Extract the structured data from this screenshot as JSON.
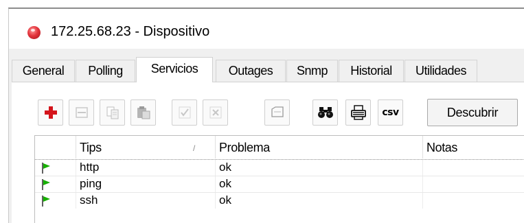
{
  "window": {
    "title": "172.25.68.23 - Dispositivo"
  },
  "tabs": [
    {
      "label": "General"
    },
    {
      "label": "Polling"
    },
    {
      "label": "Servicios",
      "active": true
    },
    {
      "label": "Outages"
    },
    {
      "label": "Snmp"
    },
    {
      "label": "Historial"
    },
    {
      "label": "Utilidades"
    }
  ],
  "toolbar": {
    "buttons": [
      {
        "icon": "add-icon",
        "enabled": true
      },
      {
        "icon": "remove-icon",
        "enabled": false
      },
      {
        "icon": "copy-icon",
        "enabled": false
      },
      {
        "icon": "paste-icon",
        "enabled": false
      },
      {
        "icon": "check-icon",
        "enabled": false
      },
      {
        "icon": "cross-icon",
        "enabled": false
      },
      {
        "icon": "comment-icon",
        "enabled": false
      },
      {
        "icon": "binoculars-icon",
        "enabled": true
      },
      {
        "icon": "printer-icon",
        "enabled": true
      },
      {
        "icon": "csv-icon",
        "enabled": true,
        "label": "csv"
      }
    ],
    "discover_label": "Descubrir"
  },
  "table": {
    "columns": [
      "Tips",
      "Problema",
      "Notas"
    ],
    "sort_indicator": "/",
    "rows": [
      {
        "tips": "http",
        "problema": "ok",
        "notas": ""
      },
      {
        "tips": "ping",
        "problema": "ok",
        "notas": ""
      },
      {
        "tips": "ssh",
        "problema": "ok",
        "notas": ""
      }
    ]
  },
  "colors": {
    "flag_green": "#17b000",
    "add_red": "#d4141b"
  }
}
